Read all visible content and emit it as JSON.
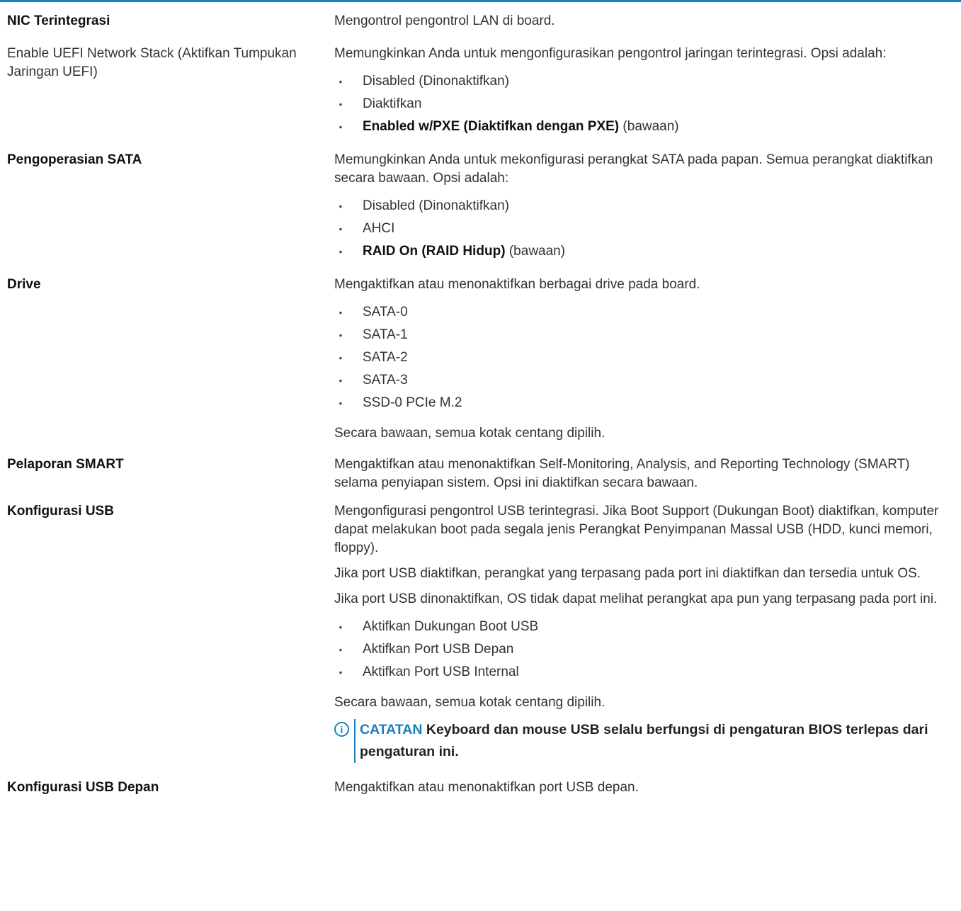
{
  "rows": [
    {
      "label": "NIC Terintegrasi",
      "desc": "Mengontrol pengontrol LAN di board."
    },
    {
      "label": "Enable UEFI Network Stack (Aktifkan Tumpukan Jaringan UEFI)",
      "desc": "Memungkinkan Anda untuk mengonfigurasikan pengontrol jaringan terintegrasi. Opsi adalah:",
      "options": [
        "Disabled (Dinonaktifkan)",
        "Diaktifkan"
      ],
      "default_option_bold": "Enabled w/PXE (Diaktifkan dengan PXE)",
      "default_suffix": "(bawaan)"
    },
    {
      "label": "Pengoperasian SATA",
      "desc": "Memungkinkan Anda untuk mekonfigurasi perangkat SATA pada papan. Semua perangkat diaktifkan secara bawaan. Opsi adalah:",
      "options": [
        "Disabled (Dinonaktifkan)",
        "AHCI"
      ],
      "default_option_bold": "RAID On (RAID Hidup)",
      "default_suffix": "(bawaan)"
    },
    {
      "label": "Drive",
      "desc": "Mengaktifkan atau menonaktifkan berbagai drive pada board.",
      "options": [
        "SATA-0",
        "SATA-1",
        "SATA-2",
        "SATA-3",
        "SSD-0 PCIe M.2"
      ],
      "footer": "Secara bawaan, semua kotak centang dipilih."
    },
    {
      "label": "Pelaporan SMART",
      "desc": "Mengaktifkan atau menonaktifkan Self-Monitoring, Analysis, and Reporting Technology (SMART) selama penyiapan sistem. Opsi ini diaktifkan secara bawaan."
    },
    {
      "label": "Konfigurasi USB",
      "desc": "Mengonfigurasi pengontrol USB terintegrasi. Jika Boot Support (Dukungan Boot) diaktifkan, komputer dapat melakukan boot pada segala jenis Perangkat Penyimpanan Massal USB (HDD, kunci memori, floppy).",
      "para2": "Jika port USB diaktifkan, perangkat yang terpasang pada port ini diaktifkan dan tersedia untuk OS.",
      "para3": "Jika port USB dinonaktifkan, OS tidak dapat melihat perangkat apa pun yang terpasang pada port ini.",
      "options": [
        "Aktifkan Dukungan Boot USB",
        "Aktifkan Port USB Depan",
        "Aktifkan Port USB Internal"
      ],
      "footer": "Secara bawaan, semua kotak centang dipilih.",
      "note_tag": "CATATAN",
      "note_text": "Keyboard dan mouse USB selalu berfungsi di pengaturan BIOS terlepas dari pengaturan ini.",
      "note_icon_glyph": "i"
    },
    {
      "label": "Konfigurasi USB Depan",
      "desc": "Mengaktifkan atau menonaktifkan port USB depan."
    }
  ],
  "bullet_glyph": "•",
  "colors": {
    "accent": "#1a7fc1",
    "text": "#333333"
  }
}
